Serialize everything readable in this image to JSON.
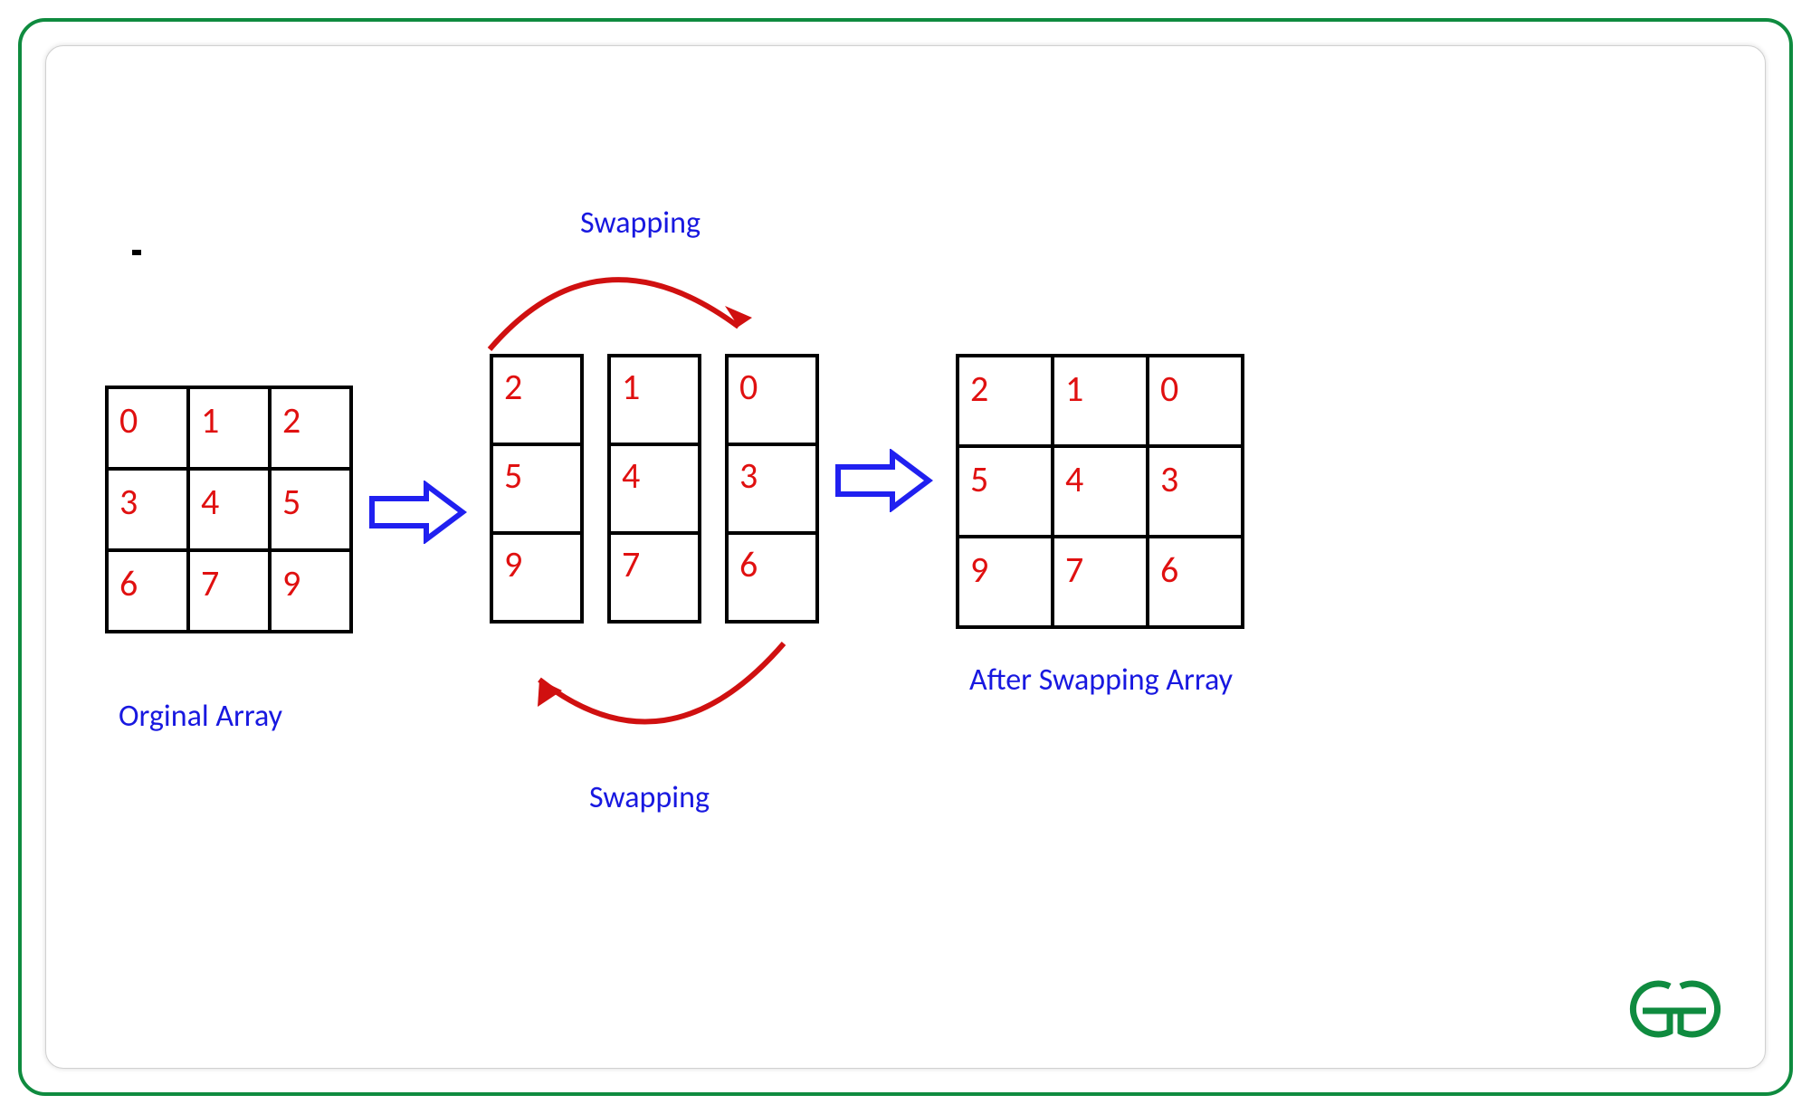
{
  "labels": {
    "swap_top": "Swapping",
    "swap_bottom": "Swapping",
    "orig": "Orginal Array",
    "after": "After Swapping Array"
  },
  "matrices": {
    "original": [
      [
        "0",
        "1",
        "2"
      ],
      [
        "3",
        "4",
        "5"
      ],
      [
        "6",
        "7",
        "9"
      ]
    ],
    "mid_col_a": [
      "2",
      "5",
      "9"
    ],
    "mid_col_b": [
      "1",
      "4",
      "7"
    ],
    "mid_col_c": [
      "0",
      "3",
      "6"
    ],
    "after": [
      [
        "2",
        "1",
        "0"
      ],
      [
        "5",
        "4",
        "3"
      ],
      [
        "9",
        "7",
        "6"
      ]
    ]
  },
  "colors": {
    "border": "#0f8b3f",
    "text_blue": "#1818e0",
    "num_red": "#e01010",
    "arrow_blue": "#2020f0",
    "swap_red": "#d01010"
  },
  "logo": "GfG"
}
